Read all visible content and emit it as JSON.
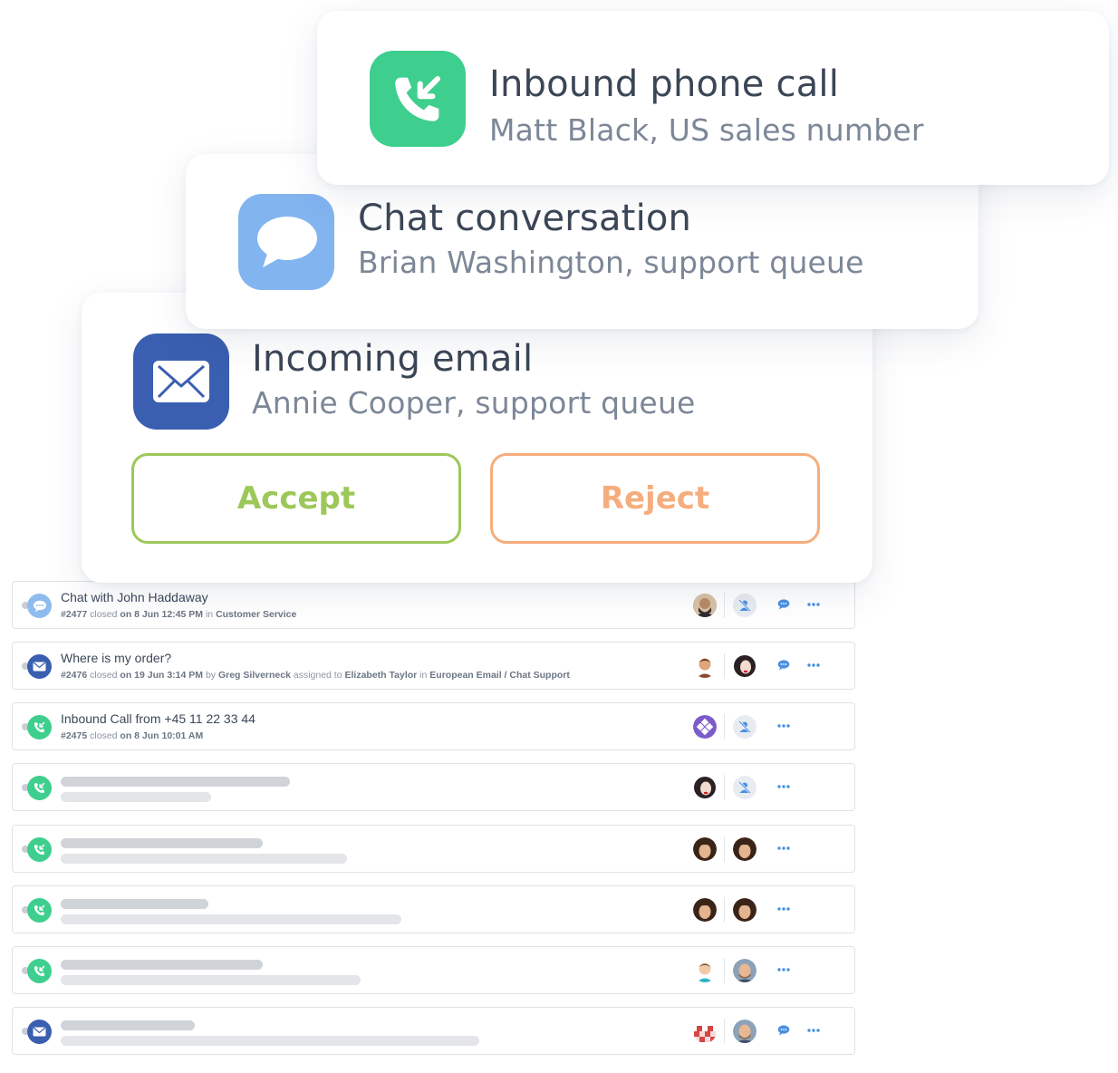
{
  "notifications": [
    {
      "id": "phone",
      "title": "Inbound phone call",
      "subtitle": "Matt Black, US sales number",
      "icon": "phone-incoming-icon",
      "color": "#3ecf8e"
    },
    {
      "id": "chat",
      "title": "Chat conversation",
      "subtitle": "Brian Washington, support queue",
      "icon": "chat-bubble-icon",
      "color": "#82b4f0"
    },
    {
      "id": "email",
      "title": "Incoming email",
      "subtitle": "Annie Cooper, support queue",
      "icon": "envelope-icon",
      "color": "#3a5fb0"
    }
  ],
  "actions": {
    "accept_label": "Accept",
    "reject_label": "Reject",
    "accept_color": "#9cc85a",
    "reject_color": "#f6ad7e"
  },
  "tickets": [
    {
      "channel": "chat",
      "title": "Chat with John Haddaway",
      "meta": {
        "id": "#2477",
        "status": "closed",
        "on": "on",
        "date": "8 Jun 12:45 PM",
        "in": "in",
        "queue": "Customer Service"
      }
    },
    {
      "channel": "email",
      "title": "Where is my order?",
      "meta": {
        "id": "#2476",
        "status": "closed",
        "on": "on",
        "date": "19 Jun 3:14 PM",
        "by": "by",
        "agent": "Greg Silverneck",
        "assigned": "assigned to",
        "assignee": "Elizabeth Taylor",
        "in": "in",
        "queue": "European Email / Chat Support"
      }
    },
    {
      "channel": "phone",
      "title": "Inbound Call from +45 11 22 33 44",
      "meta": {
        "id": "#2475",
        "status": "closed",
        "on": "on",
        "date": "8 Jun 10:01 AM"
      }
    },
    {
      "channel": "phone"
    },
    {
      "channel": "phone"
    },
    {
      "channel": "phone"
    },
    {
      "channel": "phone"
    },
    {
      "channel": "email"
    }
  ]
}
